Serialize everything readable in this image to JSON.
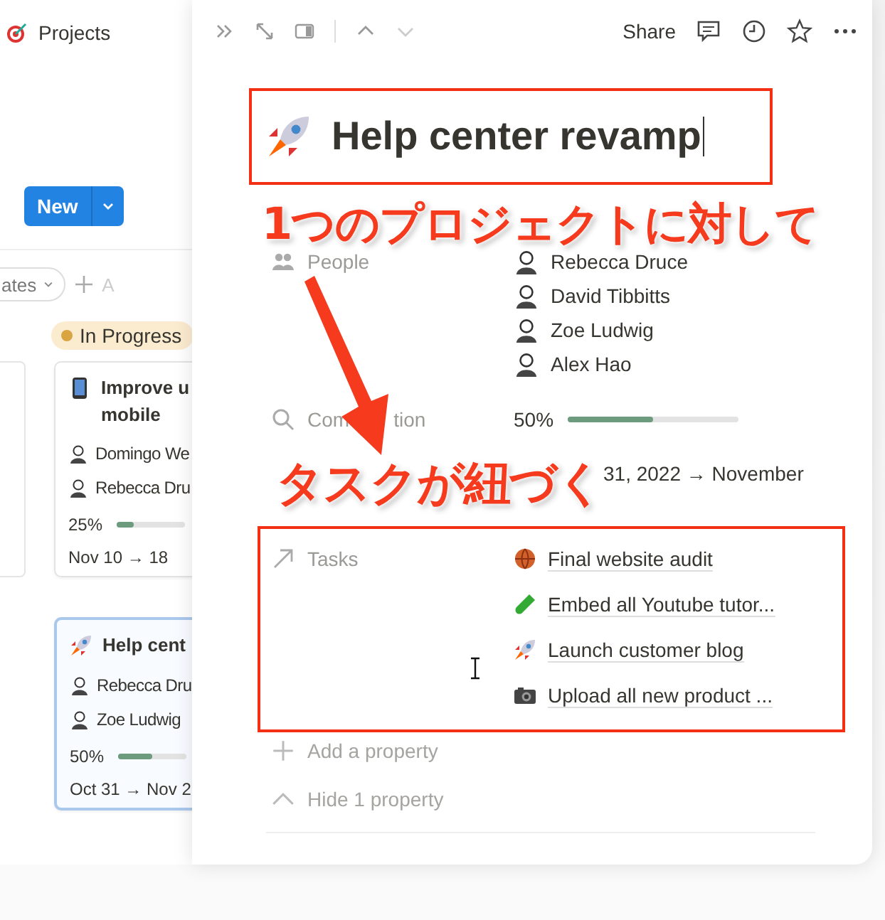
{
  "board": {
    "title": "Projects",
    "new_button": "New",
    "filter_chip": "ates",
    "add_filter": "A",
    "column": {
      "status": "In Progress",
      "color": "#d9a441"
    },
    "cards": [
      {
        "kind": "phone",
        "title_lines": [
          "Improve u",
          "mobile"
        ],
        "people": [
          "Domingo We",
          "Rebecca Dru"
        ],
        "completion": "25%",
        "level": 0.25,
        "dates": "Nov 10 → 18",
        "selected": false
      },
      {
        "kind": "rocket",
        "title_lines": [
          "Help cent"
        ],
        "people": [
          "Rebecca Dru",
          "Zoe Ludwig"
        ],
        "completion": "50%",
        "level": 0.5,
        "dates": "Oct 31 → Nov 2",
        "selected": true
      }
    ]
  },
  "page": {
    "share": "Share",
    "title": {
      "kind": "rocket",
      "text": "Help center revamp"
    },
    "properties": [
      {
        "kind": "people",
        "label": "People",
        "people": [
          "Rebecca Druce",
          "David Tibbitts",
          "Zoe Ludwig",
          "Alex Hao"
        ]
      },
      {
        "kind": "completion",
        "label_parts": [
          "Com",
          "tion"
        ],
        "value": "50%",
        "level": 0.5
      },
      {
        "kind": "date",
        "value": "31, 2022 → November"
      },
      {
        "kind": "tasks",
        "label": "Tasks",
        "tasks": [
          {
            "kind": "ball",
            "title": "Final website audit"
          },
          {
            "kind": "tube",
            "title": "Embed all Youtube tutor..."
          },
          {
            "kind": "rocket",
            "title": "Launch customer blog"
          },
          {
            "kind": "camera",
            "title": "Upload all new product ..."
          }
        ]
      }
    ],
    "add_property": "Add a property",
    "hide_property": "Hide 1 property"
  },
  "annotations": [
    "1つのプロジェクトに対して",
    "タスクが紐づく"
  ]
}
